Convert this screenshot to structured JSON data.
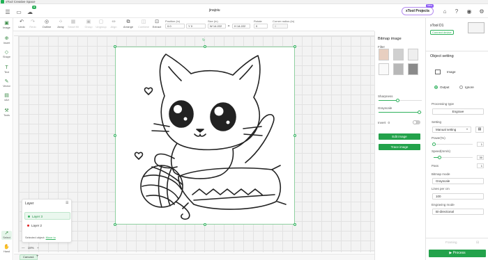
{
  "app": {
    "title": "xTool Creative Space",
    "file_name": "jinajoiu",
    "projects_label": "xTool Projects",
    "projects_badge": "New"
  },
  "toolbar": {
    "tools": [
      {
        "label": "Undo",
        "icon": "undo-icon",
        "enabled": true
      },
      {
        "label": "Redo",
        "icon": "redo-icon",
        "enabled": false
      },
      {
        "label": "Outline",
        "icon": "outline-icon",
        "enabled": true
      },
      {
        "label": "Array",
        "icon": "array-icon",
        "enabled": true
      },
      {
        "label": "Smart fill",
        "icon": "smart-fill-icon",
        "enabled": false
      },
      {
        "label": "Group",
        "icon": "group-icon",
        "enabled": false
      },
      {
        "label": "Ungroup",
        "icon": "ungroup-icon",
        "enabled": false
      },
      {
        "label": "Align",
        "icon": "align-icon",
        "enabled": false
      },
      {
        "label": "Arrange",
        "icon": "arrange-icon",
        "enabled": true
      },
      {
        "label": "Combine",
        "icon": "combine-icon",
        "enabled": false
      },
      {
        "label": "Extract",
        "icon": "extract-icon",
        "enabled": true
      }
    ],
    "position_label": "Position (in)",
    "x_value": "0.0",
    "y_value": "Y 0",
    "size_label": "Size (in)",
    "w_value": "W 14.222",
    "h_value": "H 14.222",
    "rotate_label": "Rotate",
    "rotate_value": "0",
    "corner_label": "Corner radius (in)",
    "corner_value": "0"
  },
  "leftnav": [
    {
      "label": "Image",
      "icon": "image-icon"
    },
    {
      "label": "Insert",
      "icon": "insert-icon"
    },
    {
      "label": "Shape",
      "icon": "shape-icon"
    },
    {
      "label": "Text",
      "icon": "text-icon"
    },
    {
      "label": "Vector",
      "icon": "vector-icon"
    },
    {
      "label": "xArt",
      "icon": "xart-icon"
    },
    {
      "label": "Tools",
      "icon": "tools-icon"
    }
  ],
  "leftnav_bottom": [
    {
      "label": "Select",
      "icon": "select-icon"
    },
    {
      "label": "Hand",
      "icon": "hand-icon"
    }
  ],
  "layers": {
    "title": "Layer",
    "items": [
      {
        "label": "Layer 3",
        "color": "#2fb15c",
        "selected": true
      },
      {
        "label": "Layer 2",
        "color": "#e02424",
        "selected": false
      }
    ],
    "selected_prefix": "Selected object:",
    "selected_link": "Move to"
  },
  "zoom": {
    "value": "18%"
  },
  "tabs": [
    {
      "label": "Canvas1"
    }
  ],
  "bitmap_panel": {
    "title": "Bitmap image",
    "filter_label": "Filter",
    "sharpness_label": "Sharpness",
    "sharpness_level": 0.45,
    "grayscale_label": "Grayscale",
    "grayscale_level": 0.95,
    "invert_label": "Invert",
    "invert_value": "0",
    "edit_button": "Edit image",
    "trace_button": "Trace image"
  },
  "device": {
    "name": "xTool D1",
    "status": "Connect device"
  },
  "object_setting": {
    "title": "Object setting",
    "type_label": "Image",
    "output_label": "Output",
    "ignore_label": "Ignore",
    "processing_type_label": "Processing type",
    "processing_type": "Engrave",
    "setting_label": "Setting",
    "setting_value": "Manual setting",
    "power_label": "Power(%)",
    "power_value": "1",
    "power_level": 0.01,
    "speed_label": "Speed(mm/s)",
    "speed_value": "30",
    "speed_level": 0.15,
    "pass_label": "Pass",
    "pass_value": "1",
    "bitmap_mode_label": "Bitmap mode",
    "bitmap_mode": "Grayscale",
    "lines_label": "Lines per cm",
    "lines_value": "100",
    "engraving_mode_label": "Engraving mode",
    "engraving_mode": "Bi-directional"
  },
  "bottom": {
    "framing_label": "Framing",
    "process_label": "Process"
  }
}
